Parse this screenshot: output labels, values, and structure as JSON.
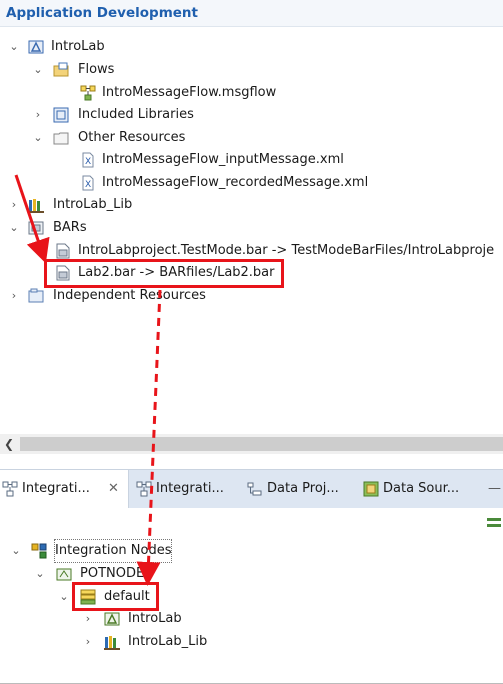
{
  "header": {
    "title": "Application Development"
  },
  "tree": {
    "introlab": "IntroLab",
    "flows": "Flows",
    "msgflow": "IntroMessageFlow.msgflow",
    "included_libraries": "Included Libraries",
    "other_resources": "Other Resources",
    "input_message": "IntroMessageFlow_inputMessage.xml",
    "recorded_message": "IntroMessageFlow_recordedMessage.xml",
    "introlab_lib": "IntroLab_Lib",
    "bars": "BARs",
    "bar1": "IntroLabproject.TestMode.bar -> TestModeBarFiles/IntroLabproje",
    "bar2": "Lab2.bar -> BARfiles/Lab2.bar",
    "independent_resources": "Independent Resources"
  },
  "tabs": [
    {
      "label": "Integrati..."
    },
    {
      "label": "Integrati..."
    },
    {
      "label": "Data Proj..."
    },
    {
      "label": "Data Sour..."
    }
  ],
  "integration_tree": {
    "integration_nodes": "Integration Nodes",
    "potnode": "POTNODE",
    "default": "default",
    "introlab": "IntroLab",
    "introlab_lib": "IntroLab_Lib"
  },
  "colors": {
    "highlight": "#e8141a",
    "title": "#1f5fae"
  }
}
